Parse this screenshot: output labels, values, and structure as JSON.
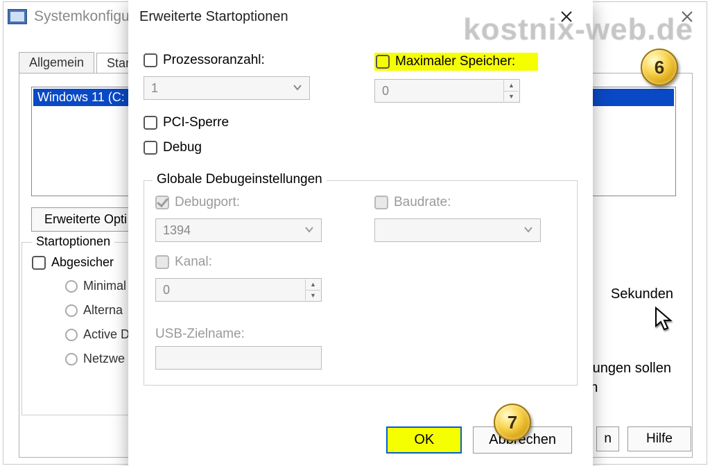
{
  "watermark": "kostnix-web.de",
  "back": {
    "title": "Systemkonfiguration",
    "tabs": {
      "allgemein": "Allgemein",
      "start": "Start"
    },
    "boot_list_item": "Windows 11 (C:",
    "advanced_options_truncated": "Erweiterte Opti",
    "boot_options_legend": "Startoptionen",
    "secure_boot_truncated": "Abgesicher",
    "radio_minimal": "Minimal",
    "radio_alterna": "Alterna",
    "radio_active": "Active D",
    "radio_netzwe": "Netzwe",
    "seconds": "Sekunden",
    "settings_truncated_1": "stellungen sollen",
    "settings_truncated_2": "elten",
    "help_btn": "Hilfe",
    "other_btn": "n"
  },
  "front": {
    "title": "Erweiterte Startoptionen",
    "processor_count_label": "Prozessoranzahl:",
    "processor_count_value": "1",
    "max_memory_label": "Maximaler Speicher:",
    "max_memory_value": "0",
    "pci_lock": "PCI-Sperre",
    "debug": "Debug",
    "debug_legend": "Globale Debugeinstellungen",
    "debugport_label": "Debugport:",
    "debugport_value": "1394",
    "baudrate_label": "Baudrate:",
    "channel_label": "Kanal:",
    "channel_value": "0",
    "usb_target_label": "USB-Zielname:",
    "ok": "OK",
    "cancel": "Abbrechen"
  },
  "badges": {
    "b6": "6",
    "b7": "7"
  }
}
